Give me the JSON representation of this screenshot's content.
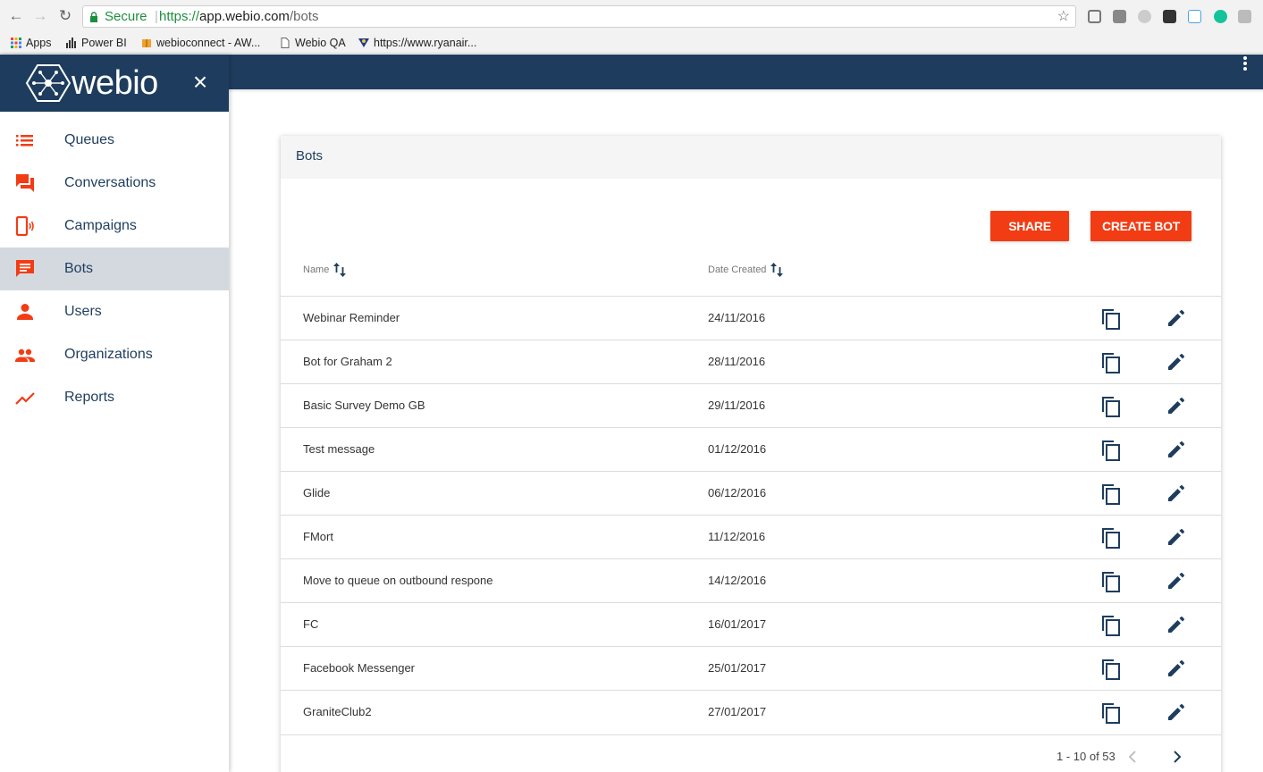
{
  "browser": {
    "secure_label": "Secure",
    "url_scheme": "https://",
    "url_host": "app.webio.com",
    "url_path": "/bots",
    "bookmarks": [
      {
        "label": "Apps"
      },
      {
        "label": "Power BI"
      },
      {
        "label": "webioconnect - AW..."
      },
      {
        "label": "Webio QA"
      },
      {
        "label": "https://www.ryanair..."
      }
    ]
  },
  "sidebar": {
    "logo_text": "webio",
    "close_glyph": "×",
    "items": [
      {
        "label": "Queues",
        "icon": "list-icon"
      },
      {
        "label": "Conversations",
        "icon": "chat-bubbles-icon"
      },
      {
        "label": "Campaigns",
        "icon": "phone-broadcast-icon"
      },
      {
        "label": "Bots",
        "icon": "message-icon",
        "active": true
      },
      {
        "label": "Users",
        "icon": "person-icon"
      },
      {
        "label": "Organizations",
        "icon": "people-icon"
      },
      {
        "label": "Reports",
        "icon": "trending-icon"
      }
    ]
  },
  "colors": {
    "header": "#1e3d5e",
    "accent": "#f23c14",
    "active_item": "#d4d9e0"
  },
  "card": {
    "title": "Bots",
    "share_label": "SHARE",
    "create_label": "CREATE BOT",
    "columns": {
      "name": "Name",
      "date": "Date Created"
    },
    "rows": [
      {
        "name": "Webinar Reminder",
        "date": "24/11/2016"
      },
      {
        "name": "Bot for Graham 2",
        "date": "28/11/2016"
      },
      {
        "name": "Basic Survey Demo GB",
        "date": "29/11/2016"
      },
      {
        "name": "Test message",
        "date": "01/12/2016"
      },
      {
        "name": "Glide",
        "date": "06/12/2016"
      },
      {
        "name": "FMort",
        "date": "11/12/2016"
      },
      {
        "name": "Move to queue on outbound respone",
        "date": "14/12/2016"
      },
      {
        "name": "FC",
        "date": "16/01/2017"
      },
      {
        "name": "Facebook Messenger",
        "date": "25/01/2017"
      },
      {
        "name": "GraniteClub2",
        "date": "27/01/2017"
      }
    ],
    "pagination": "1 - 10 of 53"
  }
}
